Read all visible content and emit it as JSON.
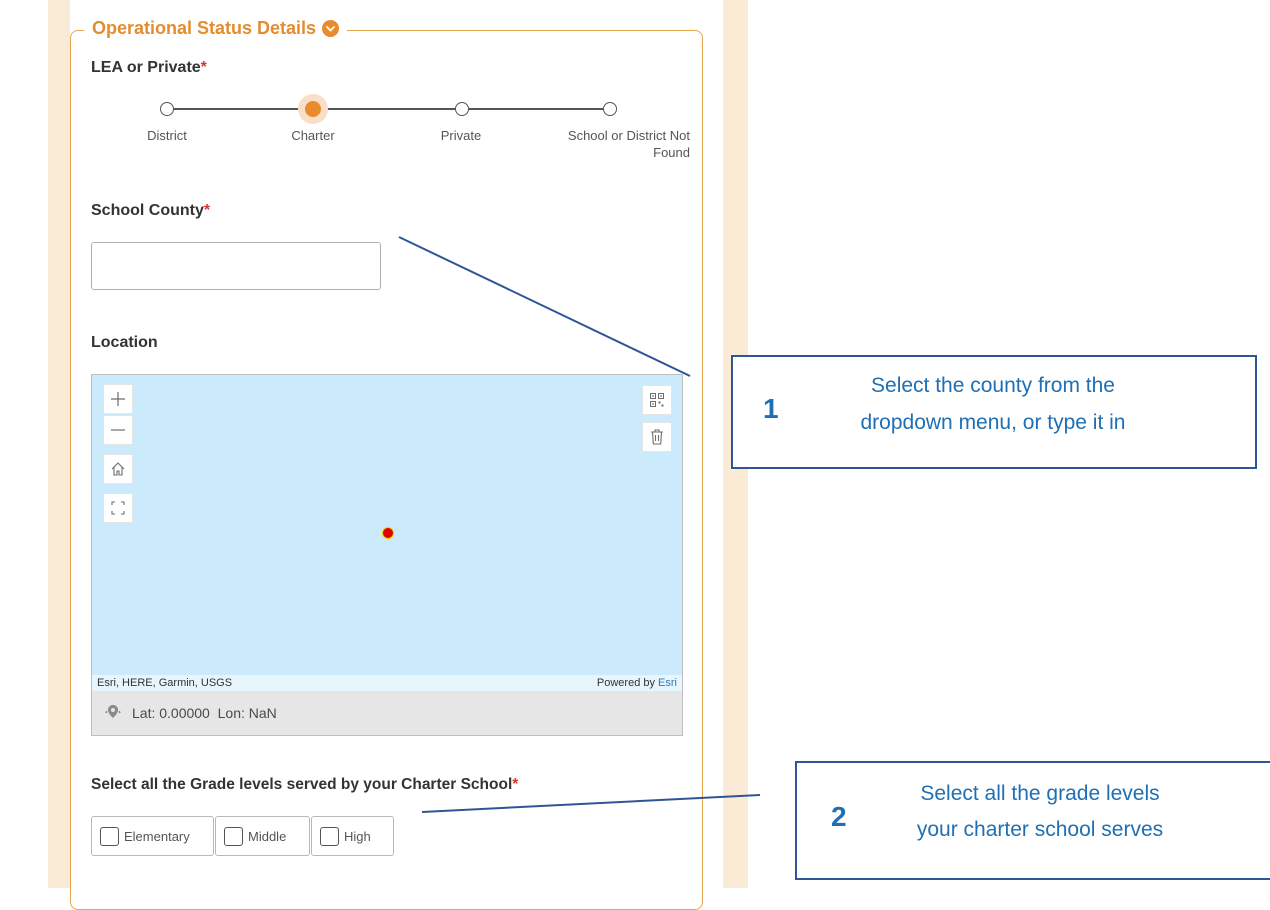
{
  "section": {
    "title": "Operational Status Details",
    "toggle_icon": "chevron-down-circle-icon"
  },
  "lea_question": {
    "label": "LEA or Private",
    "required_mark": "*",
    "options": [
      "District",
      "Charter",
      "Private",
      "School or District Not Found"
    ],
    "selected": "Charter"
  },
  "county_question": {
    "label": "School County",
    "required_mark": "*",
    "value": "",
    "placeholder": ""
  },
  "location_question": {
    "label": "Location",
    "map": {
      "zoom_in_icon": "plus-icon",
      "zoom_out_icon": "minus-icon",
      "home_icon": "home-icon",
      "fullscreen_icon": "fullscreen-icon",
      "qr_icon": "qr-code-icon",
      "delete_icon": "trash-icon",
      "attribution": "Esri, HERE, Garmin, USGS",
      "powered_by": "Powered by",
      "powered_by_link": "Esri",
      "locate_icon": "locate-icon",
      "coordinates": "Lat: 0.00000  Lon: NaN",
      "background_color": "#cbeafb",
      "point_color": "#e00000"
    }
  },
  "grades_question": {
    "label": "Select all the Grade levels served by your Charter School",
    "required_mark": "*",
    "options": [
      {
        "label": "Elementary",
        "checked": false
      },
      {
        "label": "Middle",
        "checked": false
      },
      {
        "label": "High",
        "checked": false
      }
    ]
  },
  "callouts": [
    {
      "number": "1",
      "line1": "Select the county from the",
      "line2": "dropdown menu, or type it in"
    },
    {
      "number": "2",
      "line1": "Select all the grade levels",
      "line2": "your charter school serves"
    }
  ],
  "colors": {
    "accent": "#e98b2d",
    "required": "#d23b2b",
    "callout_text": "#1f6fb5",
    "callout_border": "#2f5597",
    "side_band": "#faebd7"
  }
}
